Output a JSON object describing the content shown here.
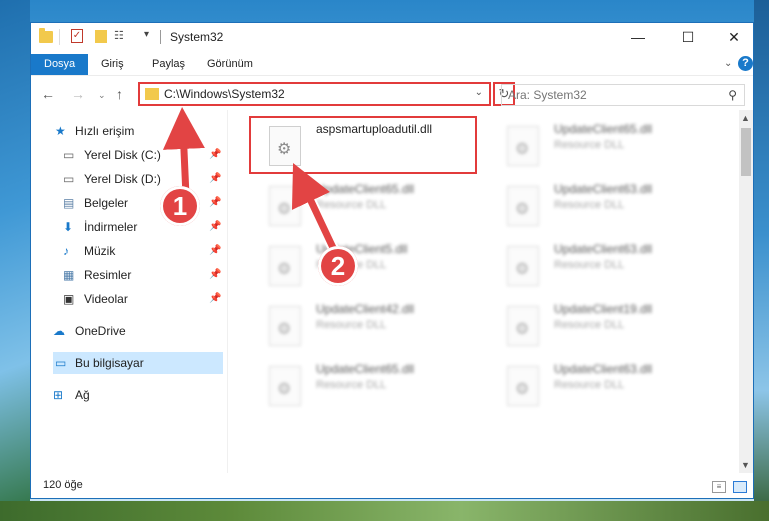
{
  "window": {
    "title": "System32",
    "minimize_glyph": "—",
    "maximize_glyph": "☐",
    "close_glyph": "✕"
  },
  "ribbon": {
    "tabs": [
      "Dosya",
      "Giriş",
      "Paylaş",
      "Görünüm"
    ],
    "help_glyph": "?"
  },
  "address": {
    "path": "C:\\Windows\\System32",
    "search_placeholder": "Ara: System32"
  },
  "sidebar": {
    "quick_access": "Hızlı erişim",
    "items": [
      {
        "label": "Yerel Disk (C:)",
        "icon": "drive-icon",
        "pinned": true
      },
      {
        "label": "Yerel Disk (D:)",
        "icon": "drive-icon",
        "pinned": true
      },
      {
        "label": "Belgeler",
        "icon": "documents-icon",
        "pinned": true
      },
      {
        "label": "İndirmeler",
        "icon": "downloads-icon",
        "pinned": true
      },
      {
        "label": "Müzik",
        "icon": "music-icon",
        "pinned": true
      },
      {
        "label": "Resimler",
        "icon": "pictures-icon",
        "pinned": true
      },
      {
        "label": "Videolar",
        "icon": "videos-icon",
        "pinned": true
      }
    ],
    "onedrive": "OneDrive",
    "this_pc": "Bu bilgisayar",
    "network": "Ağ"
  },
  "files": [
    {
      "name": "aspsmartuploadutil.dll",
      "type": "",
      "highlighted": true
    },
    {
      "name": "UpdateClient65.dll",
      "type": "Resource DLL"
    },
    {
      "name": "UpdateClient65.dll",
      "type": "Resource DLL"
    },
    {
      "name": "UpdateClient63.dll",
      "type": "Resource DLL"
    },
    {
      "name": "UpdateClient5.dll",
      "type": "Resource DLL"
    },
    {
      "name": "UpdateClient63.dll",
      "type": "Resource DLL"
    },
    {
      "name": "UpdateClient42.dll",
      "type": "Resource DLL"
    },
    {
      "name": "UpdateClient19.dll",
      "type": "Resource DLL"
    },
    {
      "name": "UpdateClient65.dll",
      "type": "Resource DLL"
    },
    {
      "name": "UpdateClient63.dll",
      "type": "Resource DLL"
    }
  ],
  "status": {
    "count": "120 öğe"
  },
  "annotations": {
    "step1": "1",
    "step2": "2",
    "color": "#e24444"
  }
}
